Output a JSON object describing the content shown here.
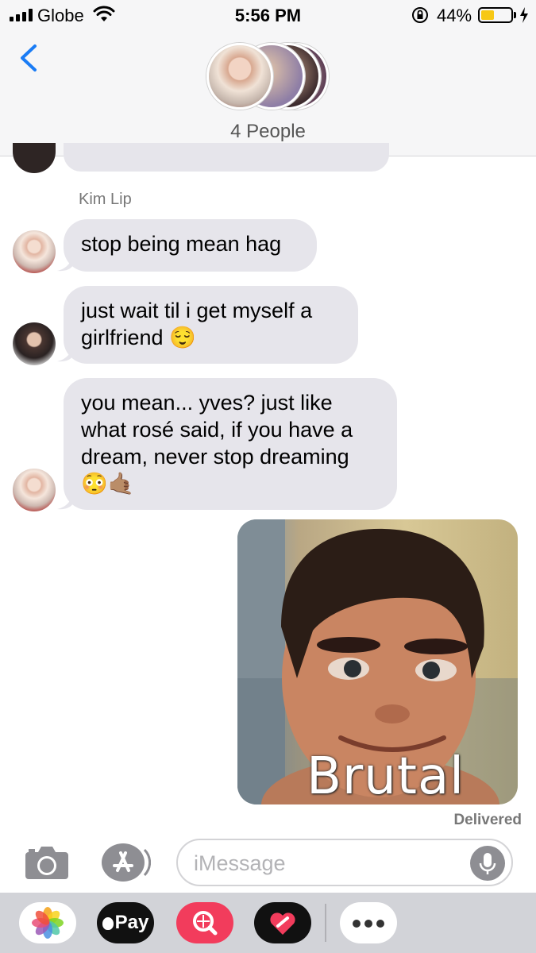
{
  "status_bar": {
    "carrier": "Globe",
    "time": "5:56 PM",
    "battery_percent": "44%",
    "battery_level": 0.44,
    "battery_color": "#f7c815",
    "signal_bars": 4,
    "icons": [
      "signal-icon",
      "wifi-icon",
      "orientation-lock-icon",
      "battery-icon",
      "charging-bolt-icon"
    ]
  },
  "header": {
    "back_icon": "chevron-left-icon",
    "group_label": "4 People",
    "accent_color": "#1a7cf5"
  },
  "messages": [
    {
      "sender": "Kim Lip",
      "text": "stop being mean hag",
      "direction": "incoming"
    },
    {
      "text": "just wait til i get myself a girlfriend 😌",
      "line1": "just wait til i get myself a",
      "line2": "girlfriend 😌",
      "direction": "incoming"
    },
    {
      "line1": "you mean... yves? just like",
      "line2": "what rosé said, if you have a",
      "line3": "dream, never stop dreaming",
      "line4": "😳🤙🏽",
      "direction": "incoming"
    },
    {
      "type": "image",
      "caption": "Brutal",
      "direction": "outgoing"
    }
  ],
  "delivery_status": "Delivered",
  "composer": {
    "placeholder": "iMessage",
    "value": "",
    "camera_icon": "camera-icon",
    "app_store_icon": "app-store-icon",
    "mic_icon": "microphone-icon"
  },
  "app_drawer": {
    "photos_icon": "photos-icon",
    "apple_pay_label": "Pay",
    "search_icon": "image-search-icon",
    "heart_icon": "digital-touch-icon",
    "more_icon": "more-icon"
  }
}
